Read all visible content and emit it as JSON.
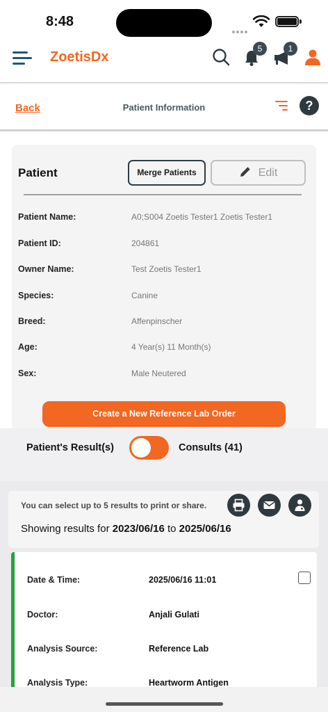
{
  "status_bar": {
    "time": "8:48"
  },
  "header": {
    "brand": "ZoetisDx",
    "notifications_count": "5",
    "announcements_count": "1"
  },
  "sub_header": {
    "back_label": "Back",
    "title": "Patient Information"
  },
  "patient_card": {
    "title": "Patient",
    "merge_label": "Merge Patients",
    "edit_label": "Edit",
    "fields": [
      {
        "label": "Patient Name:",
        "value": "A0;S004 Zoetis Tester1 Zoetis Tester1"
      },
      {
        "label": "Patient ID:",
        "value": "204861"
      },
      {
        "label": "Owner Name:",
        "value": "Test Zoetis Tester1"
      },
      {
        "label": "Species:",
        "value": "Canine"
      },
      {
        "label": "Breed:",
        "value": "Affenpinscher"
      },
      {
        "label": "Age:",
        "value": "4 Year(s) 11 Month(s)"
      },
      {
        "label": "Sex:",
        "value": "Male Neutered"
      }
    ],
    "order_button_label": "Create a New Reference Lab Order"
  },
  "toggle": {
    "left_label": "Patient's Result(s)",
    "right_label": "Consults (41)"
  },
  "results": {
    "select_hint": "You can select up to 5 results to print or share.",
    "showing_prefix": "Showing results for ",
    "date_from": "2023/06/16",
    "date_sep": " to ",
    "date_to": "2025/06/16",
    "items": [
      {
        "rows": [
          {
            "label": "Date & Time:",
            "value": "2025/06/16 11:01"
          },
          {
            "label": "Doctor:",
            "value": "Anjali Gulati"
          },
          {
            "label": "Analysis Source:",
            "value": "Reference Lab"
          },
          {
            "label": "Analysis Type:",
            "value": "Heartworm Antigen"
          }
        ]
      }
    ]
  },
  "colors": {
    "accent": "#f26722",
    "dark": "#2f3a40",
    "status_green": "#21a537"
  }
}
